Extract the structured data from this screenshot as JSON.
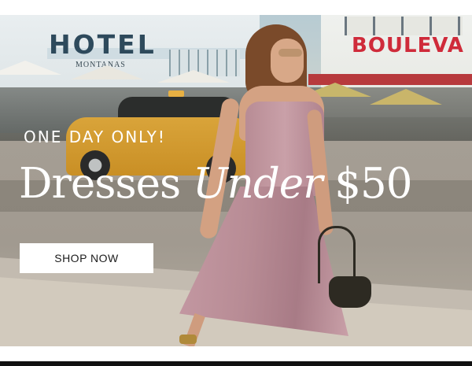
{
  "hero": {
    "eyebrow": "ONE DAY ONLY!",
    "headline_part1": "Dresses ",
    "headline_italic": "Under",
    "headline_part2": " $50",
    "cta_label": "SHOP NOW",
    "scene_signs": {
      "hotel": "HOTEL",
      "montana": "MONTANAS",
      "boulevard": "BOULEVA"
    }
  },
  "colors": {
    "text_on_image": "#ffffff",
    "button_bg": "#ffffff",
    "button_text": "#1c1c1c",
    "dress": "#b88c95",
    "taxi": "#d9a43a",
    "boulevard_sign": "#cf2b3a",
    "footer_bar": "#111111"
  }
}
